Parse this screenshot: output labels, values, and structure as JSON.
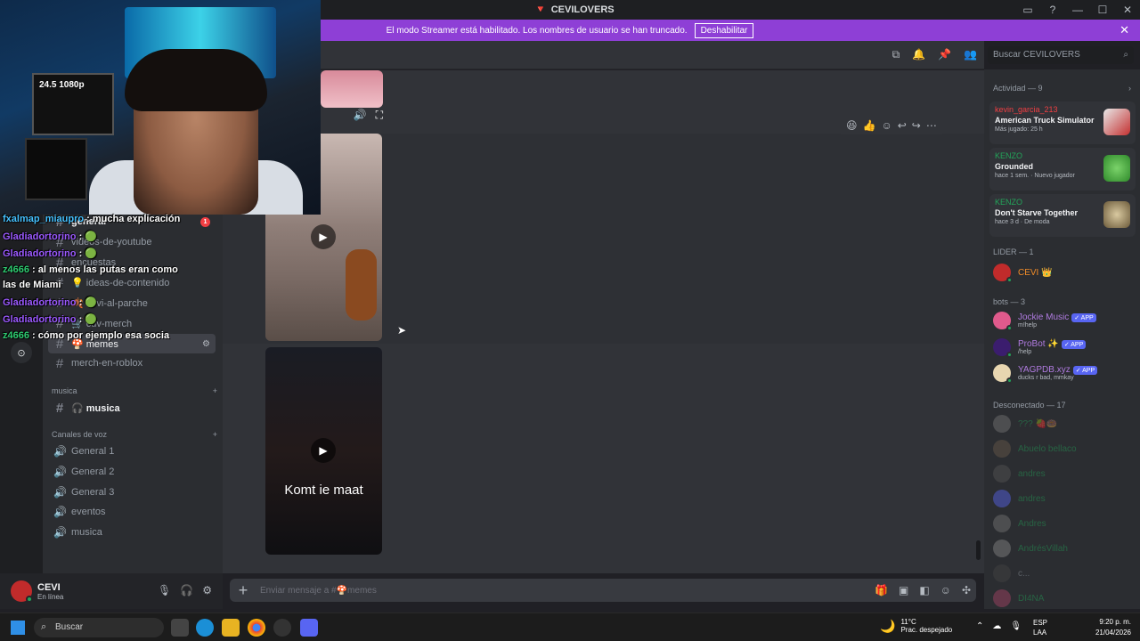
{
  "window": {
    "title": "CEVILOVERS",
    "controls": [
      "▭",
      "?",
      "—",
      "☐",
      "✕"
    ]
  },
  "banner": {
    "text": "El modo Streamer está habilitado. Los nombres de usuario se han truncado.",
    "button": "Deshabilitar"
  },
  "header": {
    "search_placeholder": "Buscar CEVILOVERS"
  },
  "sidebar": {
    "channels_top": [
      {
        "label": "general"
      },
      {
        "label": "videos-de-youtube"
      },
      {
        "label": "encuestas"
      },
      {
        "label": "💡 ideas-de-contenido"
      },
      {
        "label": "🍂 cevi-al-parche"
      },
      {
        "label": "🛒 cuv-merch"
      },
      {
        "label": "🍄 memes"
      },
      {
        "label": "merch-en-roblox"
      }
    ],
    "unread_badge": "1",
    "category_music": "musica",
    "music_channel": "🎧 musica",
    "category_voice": "Canales de voz",
    "voice_channels": [
      "General 1",
      "General 2",
      "General 3",
      "eventos",
      "musica"
    ]
  },
  "user": {
    "name": "CEVI",
    "status": "En línea"
  },
  "chat": {
    "video_caption": "Komt ie maat",
    "composer_placeholder": "Enviar mensaje a #🍄memes"
  },
  "members": {
    "activity_header": "Actividad — 9",
    "activities": [
      {
        "user": "kevin_garcia_213",
        "game": "American Truck Simulator",
        "meta": "Más jugado: 25 h",
        "color": "#f23f43"
      },
      {
        "user": "KENZO",
        "game": "Grounded",
        "meta": "hace 1 sem.  ·  Nuevo jugador",
        "color": "#23a55a"
      },
      {
        "user": "KENZO",
        "game": "Don't Starve Together",
        "meta": "hace 3 d  ·  De moda",
        "color": "#23a55a"
      }
    ],
    "leader_header": "LIDER — 1",
    "leader": "CEVI 👑",
    "bots_header": "bots — 3",
    "bots": [
      {
        "name": "Jockie Music",
        "sub": "m!help",
        "badge": "✓ APP"
      },
      {
        "name": "ProBot ✨",
        "sub": "/help",
        "badge": "✓ APP"
      },
      {
        "name": "YAGPDB.xyz",
        "sub": "ducks r bad, mmkay",
        "badge": "✓ APP"
      }
    ],
    "offline_header": "Desconectado — 17",
    "offline": [
      "??? 🍓🍩",
      "Abuelo bellaco",
      "andres",
      "andres",
      "Andres",
      "AndrésVillah",
      "c...",
      "DI4NA"
    ]
  },
  "overlay_chat": [
    {
      "user": "fxalmap_miaupro",
      "text": ": mucha explicación",
      "cls": "u1"
    },
    {
      "user": "Gladiadortorino",
      "text": ": 🟢",
      "cls": "u2"
    },
    {
      "user": "Gladiadortorino",
      "text": ": 🟢",
      "cls": "u2"
    },
    {
      "user": "z4666",
      "text": ": al menos las putas eran como",
      "cls": "u3"
    },
    {
      "user": "",
      "text": "las de Miami",
      "cls": ""
    },
    {
      "user": "Gladiadortorino",
      "text": ": 🟢",
      "cls": "u2"
    },
    {
      "user": "Gladiadortorino",
      "text": ": 🟢",
      "cls": "u2"
    },
    {
      "user": "z4666",
      "text": ": cómo por ejemplo esa socia",
      "cls": "u3"
    }
  ],
  "taskbar": {
    "search": "Buscar",
    "temp": "11°C",
    "weather": "Prac. despejado",
    "lang1": "ESP",
    "lang2": "LAA",
    "time": "9:20 p. m.",
    "date": "21/04/2026"
  },
  "cam": {
    "overlay_text": "24.5 1080p"
  },
  "colors": {
    "accent": "#5865f2",
    "banner": "#8e3fd6",
    "online": "#23a55a"
  }
}
